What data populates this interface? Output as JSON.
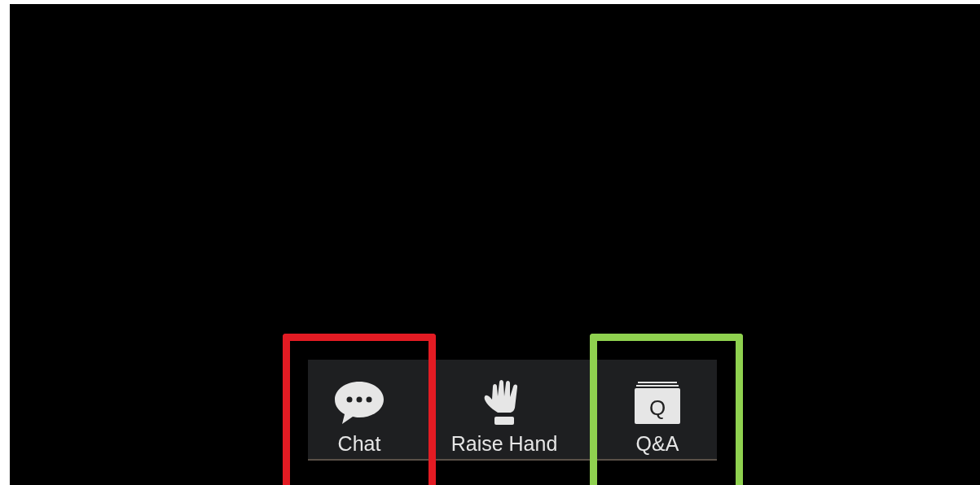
{
  "toolbar": {
    "buttons": [
      {
        "kind": "chat",
        "label": "Chat",
        "color": "#e31b23"
      },
      {
        "kind": "raise-hand",
        "label": "Raise Hand"
      },
      {
        "kind": "qa",
        "label": "Q&A",
        "icon_text": "Q",
        "color": "#8fd14f"
      }
    ]
  }
}
